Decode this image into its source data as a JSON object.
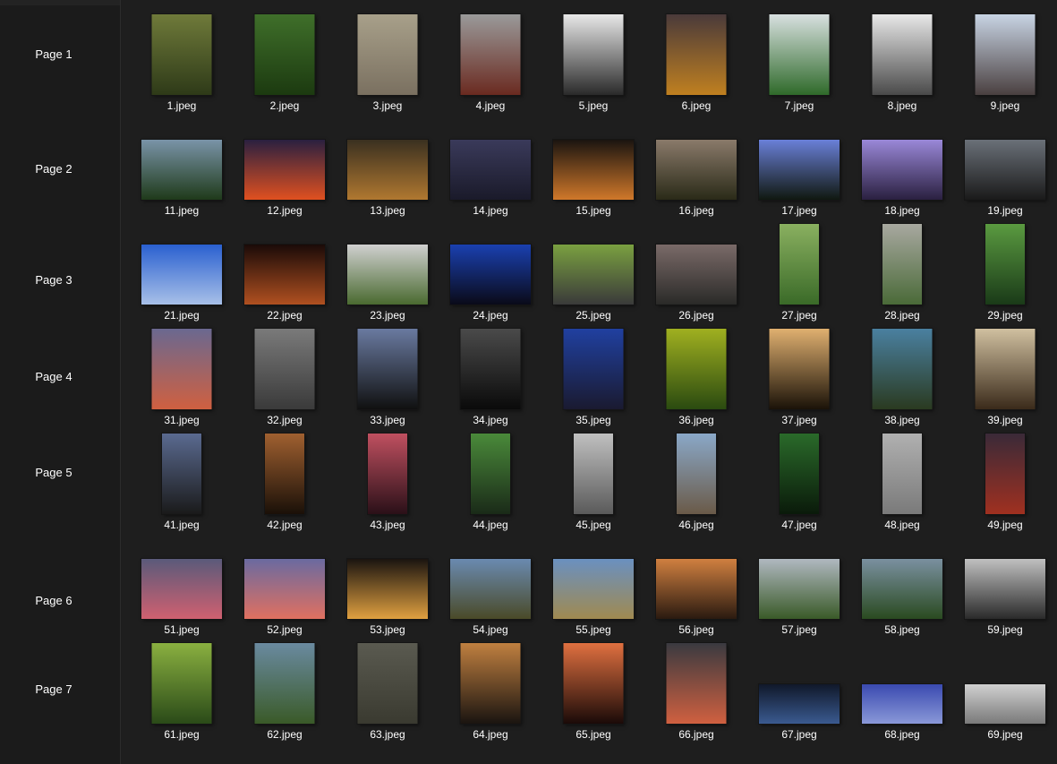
{
  "pages": [
    {
      "label": "Page 1",
      "files": [
        {
          "name": "1.jpeg",
          "o": "p",
          "c": [
            "#6f7a3a",
            "#2e3a18"
          ]
        },
        {
          "name": "2.jpeg",
          "o": "p",
          "c": [
            "#3f6f2a",
            "#1c3a10"
          ]
        },
        {
          "name": "3.jpeg",
          "o": "p",
          "c": [
            "#a8a08a",
            "#7a7060"
          ]
        },
        {
          "name": "4.jpeg",
          "o": "p",
          "c": [
            "#9a9a9a",
            "#6a2a20"
          ]
        },
        {
          "name": "5.jpeg",
          "o": "p",
          "c": [
            "#e8e8e8",
            "#2a2a2a"
          ]
        },
        {
          "name": "6.jpeg",
          "o": "p",
          "c": [
            "#4a3a3a",
            "#c08020"
          ]
        },
        {
          "name": "7.jpeg",
          "o": "p",
          "c": [
            "#d8e0e0",
            "#2f6a2a"
          ]
        },
        {
          "name": "8.jpeg",
          "o": "p",
          "c": [
            "#e8e8e8",
            "#4a4a4a"
          ]
        },
        {
          "name": "9.jpeg",
          "o": "p",
          "c": [
            "#c8d4e4",
            "#4a4040"
          ]
        }
      ]
    },
    {
      "label": "Page 2",
      "files": [
        {
          "name": "11.jpeg",
          "o": "l",
          "c": [
            "#7a94a8",
            "#1f3a1a"
          ]
        },
        {
          "name": "12.jpeg",
          "o": "l",
          "c": [
            "#2a2040",
            "#e05020"
          ]
        },
        {
          "name": "13.jpeg",
          "o": "l",
          "c": [
            "#3a3020",
            "#b07830"
          ]
        },
        {
          "name": "14.jpeg",
          "o": "l",
          "c": [
            "#3a3a5a",
            "#1a1a2a"
          ]
        },
        {
          "name": "15.jpeg",
          "o": "l",
          "c": [
            "#1a1410",
            "#d0782a"
          ]
        },
        {
          "name": "16.jpeg",
          "o": "l",
          "c": [
            "#8a7a6a",
            "#2a2a18"
          ]
        },
        {
          "name": "17.jpeg",
          "o": "l",
          "c": [
            "#6a80d8",
            "#101810"
          ]
        },
        {
          "name": "18.jpeg",
          "o": "l",
          "c": [
            "#9a88d8",
            "#2a2040"
          ]
        },
        {
          "name": "19.jpeg",
          "o": "l",
          "c": [
            "#6a7078",
            "#1a1a1a"
          ]
        }
      ]
    },
    {
      "label": "Page 3",
      "files": [
        {
          "name": "21.jpeg",
          "o": "l",
          "c": [
            "#2a60d0",
            "#a8c0e8"
          ]
        },
        {
          "name": "22.jpeg",
          "o": "l",
          "c": [
            "#1a0a08",
            "#b05020"
          ]
        },
        {
          "name": "23.jpeg",
          "o": "l",
          "c": [
            "#d0d0d0",
            "#4a6a30"
          ]
        },
        {
          "name": "24.jpeg",
          "o": "l",
          "c": [
            "#1a40b0",
            "#0a0a18"
          ]
        },
        {
          "name": "25.jpeg",
          "o": "l",
          "c": [
            "#7aa040",
            "#3a3a3a"
          ]
        },
        {
          "name": "26.jpeg",
          "o": "l",
          "c": [
            "#7a6a68",
            "#2a2a28"
          ]
        },
        {
          "name": "27.jpeg",
          "o": "t",
          "c": [
            "#8ab060",
            "#3a6a28"
          ]
        },
        {
          "name": "28.jpeg",
          "o": "t",
          "c": [
            "#a8a8a0",
            "#4a6a38"
          ]
        },
        {
          "name": "29.jpeg",
          "o": "t",
          "c": [
            "#5a9a40",
            "#1a3a18"
          ]
        }
      ]
    },
    {
      "label": "Page 4",
      "files": [
        {
          "name": "31.jpeg",
          "o": "p",
          "c": [
            "#6a6890",
            "#d06040"
          ]
        },
        {
          "name": "32.jpeg",
          "o": "p",
          "c": [
            "#7a7a7a",
            "#3a3a3a"
          ]
        },
        {
          "name": "33.jpeg",
          "o": "p",
          "c": [
            "#6a7aa0",
            "#101010"
          ]
        },
        {
          "name": "34.jpeg",
          "o": "p",
          "c": [
            "#4a4a4a",
            "#0a0a0a"
          ]
        },
        {
          "name": "35.jpeg",
          "o": "p",
          "c": [
            "#2040a0",
            "#1a1a30"
          ]
        },
        {
          "name": "36.jpeg",
          "o": "p",
          "c": [
            "#a0b020",
            "#2a4a10"
          ]
        },
        {
          "name": "37.jpeg",
          "o": "p",
          "c": [
            "#e0b070",
            "#1a1208"
          ]
        },
        {
          "name": "38.jpeg",
          "o": "p",
          "c": [
            "#4a80a0",
            "#2a3a20"
          ]
        },
        {
          "name": "39.jpeg",
          "o": "p",
          "c": [
            "#d0c0a0",
            "#3a2a1a"
          ]
        }
      ]
    },
    {
      "label": "Page 5",
      "files": [
        {
          "name": "41.jpeg",
          "o": "t",
          "c": [
            "#5a6a90",
            "#1a1a1a"
          ]
        },
        {
          "name": "42.jpeg",
          "o": "t",
          "c": [
            "#a06030",
            "#1a1008"
          ]
        },
        {
          "name": "43.jpeg",
          "o": "t",
          "c": [
            "#c05060",
            "#2a1018"
          ]
        },
        {
          "name": "44.jpeg",
          "o": "t",
          "c": [
            "#4a8a3a",
            "#1a2a18"
          ]
        },
        {
          "name": "45.jpeg",
          "o": "t",
          "c": [
            "#c0c0c0",
            "#5a5a5a"
          ]
        },
        {
          "name": "46.jpeg",
          "o": "t",
          "c": [
            "#8aa8c8",
            "#6a5a48"
          ]
        },
        {
          "name": "47.jpeg",
          "o": "t",
          "c": [
            "#2a6a2a",
            "#0a1a0a"
          ]
        },
        {
          "name": "48.jpeg",
          "o": "t",
          "c": [
            "#b0b0b0",
            "#7a7a7a"
          ]
        },
        {
          "name": "49.jpeg",
          "o": "t",
          "c": [
            "#3a2a38",
            "#a03020"
          ]
        }
      ]
    },
    {
      "label": "Page 6",
      "files": [
        {
          "name": "51.jpeg",
          "o": "l",
          "c": [
            "#5a5a7a",
            "#d06070"
          ]
        },
        {
          "name": "52.jpeg",
          "o": "l",
          "c": [
            "#6a6aa0",
            "#e07060"
          ]
        },
        {
          "name": "53.jpeg",
          "o": "l",
          "c": [
            "#1a1410",
            "#e0a040"
          ]
        },
        {
          "name": "54.jpeg",
          "o": "l",
          "c": [
            "#6a8ab0",
            "#4a4a28"
          ]
        },
        {
          "name": "55.jpeg",
          "o": "l",
          "c": [
            "#6a90c0",
            "#a08a50"
          ]
        },
        {
          "name": "56.jpeg",
          "o": "l",
          "c": [
            "#d08040",
            "#2a1a10"
          ]
        },
        {
          "name": "57.jpeg",
          "o": "l",
          "c": [
            "#b0b8c0",
            "#3a5a28"
          ]
        },
        {
          "name": "58.jpeg",
          "o": "l",
          "c": [
            "#7a90a0",
            "#2a4a20"
          ]
        },
        {
          "name": "59.jpeg",
          "o": "l",
          "c": [
            "#c0c0c0",
            "#2a2a2a"
          ]
        }
      ]
    },
    {
      "label": "Page 7",
      "files": [
        {
          "name": "61.jpeg",
          "o": "p",
          "c": [
            "#8ab040",
            "#2a4a18"
          ]
        },
        {
          "name": "62.jpeg",
          "o": "p",
          "c": [
            "#6a8aa0",
            "#3a5a28"
          ]
        },
        {
          "name": "63.jpeg",
          "o": "p",
          "c": [
            "#5a5a50",
            "#3a3a30"
          ]
        },
        {
          "name": "64.jpeg",
          "o": "p",
          "c": [
            "#c08040",
            "#1a1410"
          ]
        },
        {
          "name": "65.jpeg",
          "o": "p",
          "c": [
            "#e07040",
            "#1a0a08"
          ]
        },
        {
          "name": "66.jpeg",
          "o": "p",
          "c": [
            "#3a3a40",
            "#d06040"
          ]
        },
        {
          "name": "67.jpeg",
          "o": "s",
          "c": [
            "#10182a",
            "#3a5a90"
          ]
        },
        {
          "name": "68.jpeg",
          "o": "s",
          "c": [
            "#3a4ab0",
            "#8a98d8"
          ]
        },
        {
          "name": "69.jpeg",
          "o": "s",
          "c": [
            "#d0d0d0",
            "#7a7a7a"
          ]
        }
      ]
    }
  ]
}
